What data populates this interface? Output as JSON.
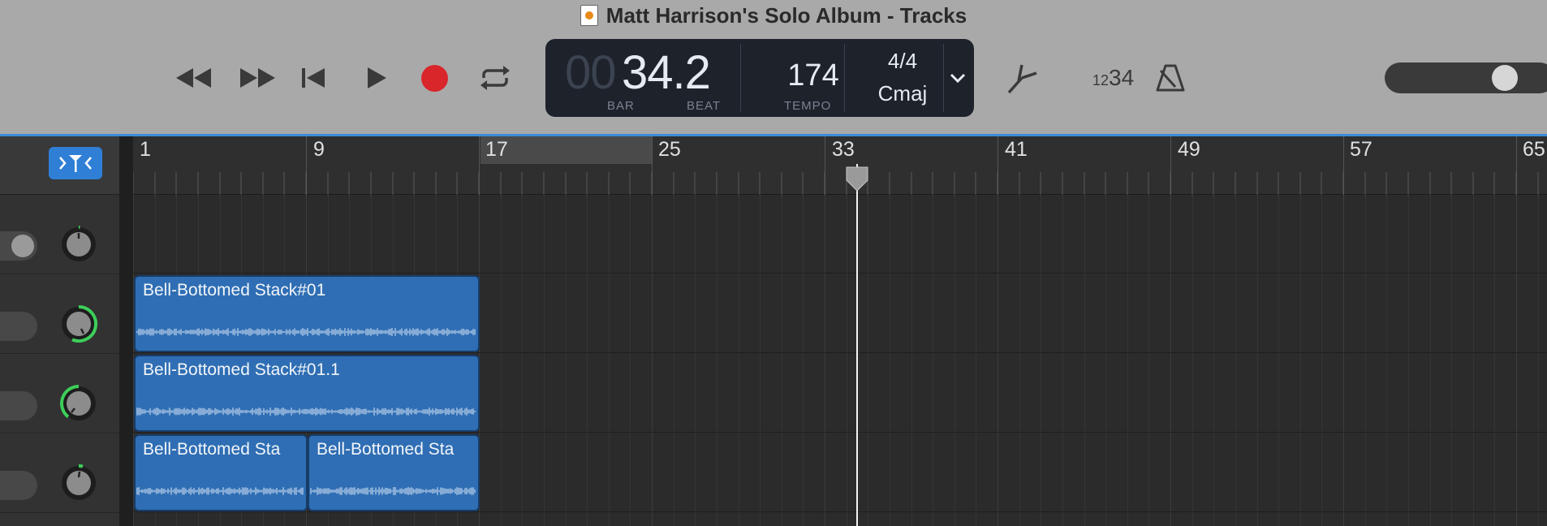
{
  "window": {
    "title": "Matt Harrison's Solo Album - Tracks",
    "doc_icon": "garageband-doc-icon"
  },
  "transport": {
    "rewind_icon": "rewind-icon",
    "forward_icon": "fast-forward-icon",
    "to_start_icon": "go-to-beginning-icon",
    "play_icon": "play-icon",
    "record_icon": "record-icon",
    "cycle_icon": "cycle-icon",
    "record_color": "#d9262b"
  },
  "lcd": {
    "bar_dim": "00",
    "bar_value": "34.2",
    "bar_label": "BAR",
    "beat_label": "BEAT",
    "tempo": "174",
    "tempo_label": "TEMPO",
    "time_signature": "4/4",
    "key": "Cmaj"
  },
  "tools": {
    "tuner_icon": "tuner-icon",
    "count_in_small": "12",
    "count_in_large": "34",
    "metronome_icon": "metronome-icon"
  },
  "ruler": {
    "bars": [
      "1",
      "9",
      "17",
      "25",
      "33",
      "41",
      "49",
      "57",
      "65"
    ],
    "cycle_range": [
      "17",
      "25"
    ]
  },
  "regions": [
    {
      "name": "Bell-Bottomed Stack#01"
    },
    {
      "name": "Bell-Bottomed Stack#01.1"
    },
    {
      "name": "Bell-Bottomed Sta"
    },
    {
      "name": "Bell-Bottomed Sta"
    }
  ],
  "colors": {
    "region_fill": "#2f6eb4",
    "accent_blue": "#3d8bd8",
    "knob_green": "#3ccf5a"
  },
  "playhead": {
    "bar": 34.2
  }
}
